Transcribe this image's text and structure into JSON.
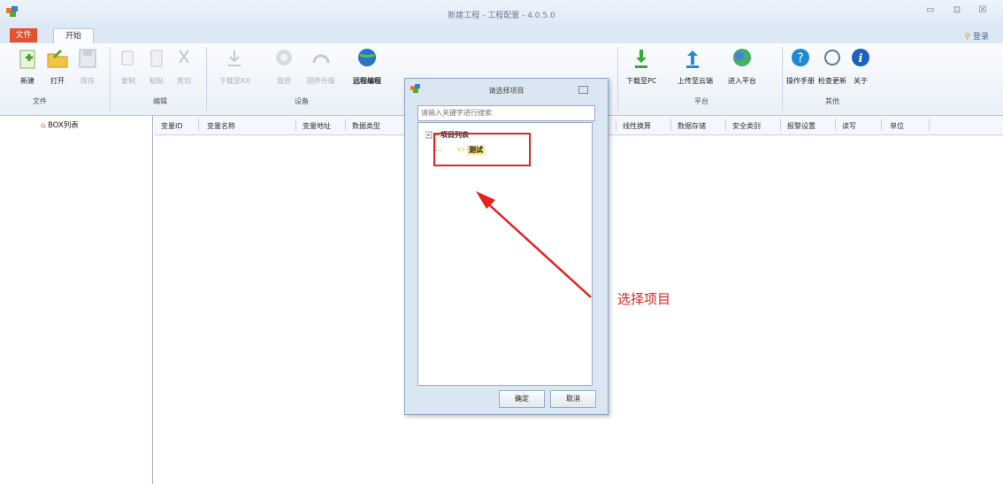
{
  "window": {
    "title": "新建工程 - 工程配置 - 4.0.5.0",
    "controls": {
      "minimize": "▭",
      "restore": "⊡",
      "close": "☒"
    }
  },
  "ribbon_tabs": {
    "file": "文件",
    "start": "开始",
    "login": "登录"
  },
  "ribbon": {
    "buttons": [
      {
        "label": "新建",
        "icon": "new-file-icon"
      },
      {
        "label": "打开",
        "icon": "open-folder-icon"
      },
      {
        "label": "保存",
        "icon": "save-icon"
      },
      {
        "label": "复制",
        "icon": "copy-icon"
      },
      {
        "label": "粘贴",
        "icon": "paste-icon"
      },
      {
        "label": "剪切",
        "icon": "cut-icon"
      },
      {
        "label": "下载至RX",
        "icon": "download-icon"
      },
      {
        "label": "监控",
        "icon": "monitor-icon"
      },
      {
        "label": "固件升级",
        "icon": "firmware-icon"
      },
      {
        "label": "远程编程",
        "icon": "globe-icon"
      },
      {
        "label": "下载至PC",
        "icon": "download-pc-icon"
      },
      {
        "label": "上传至云端",
        "icon": "upload-cloud-icon"
      },
      {
        "label": "进入平台",
        "icon": "platform-icon"
      },
      {
        "label": "操作手册",
        "icon": "help-icon"
      },
      {
        "label": "检查更新",
        "icon": "update-icon"
      },
      {
        "label": "关于",
        "icon": "info-icon"
      }
    ],
    "groups": [
      "文件",
      "编辑",
      "设备",
      "平台",
      "其他"
    ]
  },
  "sidebar": {
    "item": "BOX列表"
  },
  "grid": {
    "columns": [
      "变量ID",
      "变量名称",
      "变量地址",
      "数据类型",
      "线性换算",
      "数据存储",
      "安全类别",
      "报警设置",
      "读写",
      "单位"
    ]
  },
  "dialog": {
    "title": "请选择项目",
    "search_placeholder": "请输入关键字进行搜索",
    "tree_root": "项目列表",
    "tree_child": "测试",
    "ok": "确定",
    "cancel": "取消"
  },
  "annotation": {
    "text": "选择项目",
    "color": "#e3231f"
  }
}
